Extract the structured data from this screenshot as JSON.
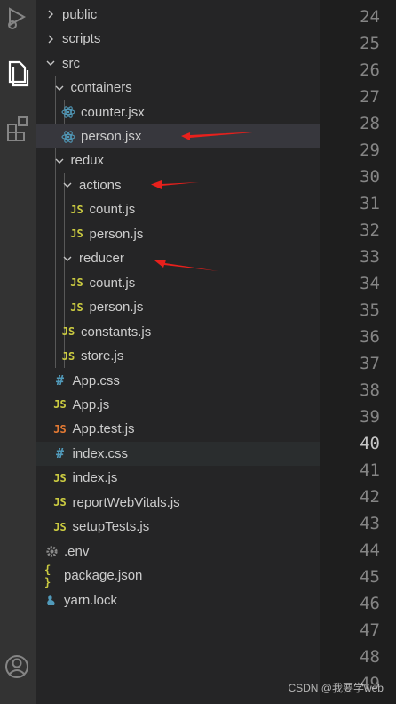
{
  "explorer": {
    "items": [
      {
        "label": "public",
        "type": "folder",
        "expanded": false
      },
      {
        "label": "scripts",
        "type": "folder",
        "expanded": false
      },
      {
        "label": "src",
        "type": "folder",
        "expanded": true
      },
      {
        "label": "containers",
        "type": "folder",
        "expanded": true
      },
      {
        "label": "counter.jsx",
        "type": "react"
      },
      {
        "label": "person.jsx",
        "type": "react",
        "selected": true
      },
      {
        "label": "redux",
        "type": "folder",
        "expanded": true
      },
      {
        "label": "actions",
        "type": "folder",
        "expanded": true
      },
      {
        "label": "count.js",
        "type": "js"
      },
      {
        "label": "person.js",
        "type": "js"
      },
      {
        "label": "reducer",
        "type": "folder",
        "expanded": true
      },
      {
        "label": "count.js",
        "type": "js"
      },
      {
        "label": "person.js",
        "type": "js"
      },
      {
        "label": "constants.js",
        "type": "js"
      },
      {
        "label": "store.js",
        "type": "js"
      },
      {
        "label": "App.css",
        "type": "css"
      },
      {
        "label": "App.js",
        "type": "js"
      },
      {
        "label": "App.test.js",
        "type": "test"
      },
      {
        "label": "index.css",
        "type": "css",
        "hover": true
      },
      {
        "label": "index.js",
        "type": "js"
      },
      {
        "label": "reportWebVitals.js",
        "type": "js"
      },
      {
        "label": "setupTests.js",
        "type": "js"
      },
      {
        "label": ".env",
        "type": "env"
      },
      {
        "label": "package.json",
        "type": "json"
      },
      {
        "label": "yarn.lock",
        "type": "yarn"
      }
    ]
  },
  "icons": {
    "js_glyph": "JS",
    "css_glyph": "#",
    "json_glyph": "{ }"
  },
  "editor": {
    "line_numbers": [
      "24",
      "25",
      "26",
      "27",
      "28",
      "29",
      "30",
      "31",
      "32",
      "33",
      "34",
      "35",
      "36",
      "37",
      "38",
      "39",
      "40",
      "41",
      "42",
      "43",
      "44",
      "45",
      "46",
      "47",
      "48",
      "49"
    ],
    "current_line": "40"
  },
  "watermark": "CSDN @我要学web",
  "colors": {
    "js": "#cbcb41",
    "css": "#519aba",
    "react": "#519aba",
    "test": "#e37933",
    "arrow": "#e8201c"
  }
}
